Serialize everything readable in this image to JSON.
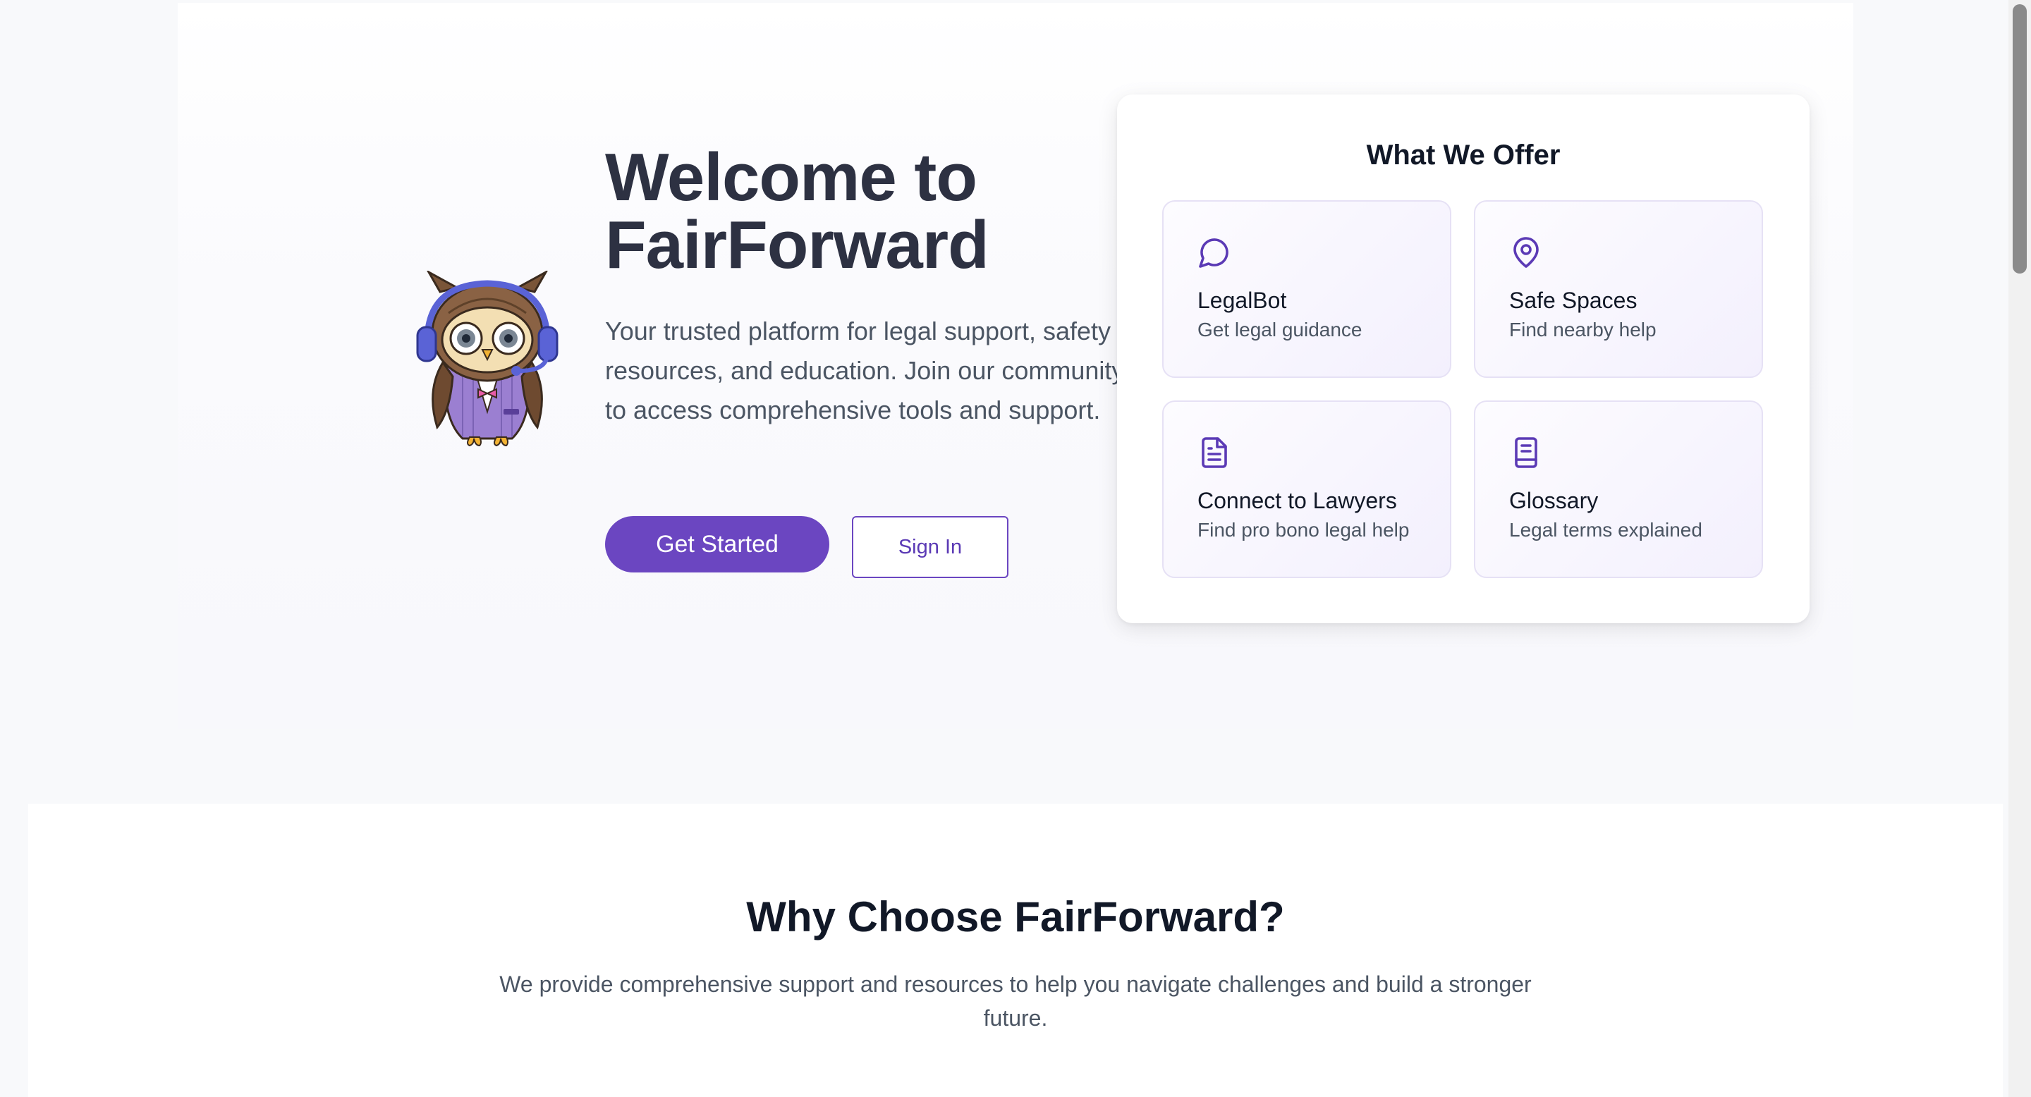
{
  "hero": {
    "title_line1": "Welcome to",
    "title_line2": "FairForward",
    "description": "Your trusted platform for legal support, safety resources, and education. Join our community to access comprehensive tools and support.",
    "get_started_label": "Get Started",
    "sign_in_label": "Sign In",
    "mascot": "owl-mascot-with-headset"
  },
  "offer": {
    "title": "What We Offer",
    "tiles": [
      {
        "title": "LegalBot",
        "subtitle": "Get legal guidance",
        "icon": "chat-bubble-icon"
      },
      {
        "title": "Safe Spaces",
        "subtitle": "Find nearby help",
        "icon": "map-pin-icon"
      },
      {
        "title": "Connect to Lawyers",
        "subtitle": "Find pro bono legal help",
        "icon": "document-icon"
      },
      {
        "title": "Glossary",
        "subtitle": "Legal terms explained",
        "icon": "book-icon"
      }
    ]
  },
  "why": {
    "title": "Why Choose FairForward?",
    "description": "We provide comprehensive support and resources to help you navigate challenges and build a stronger future."
  },
  "colors": {
    "accent": "#6b46c1",
    "heading": "#2d3142",
    "body_text": "#4b5563",
    "background": "#f8f9fb"
  }
}
